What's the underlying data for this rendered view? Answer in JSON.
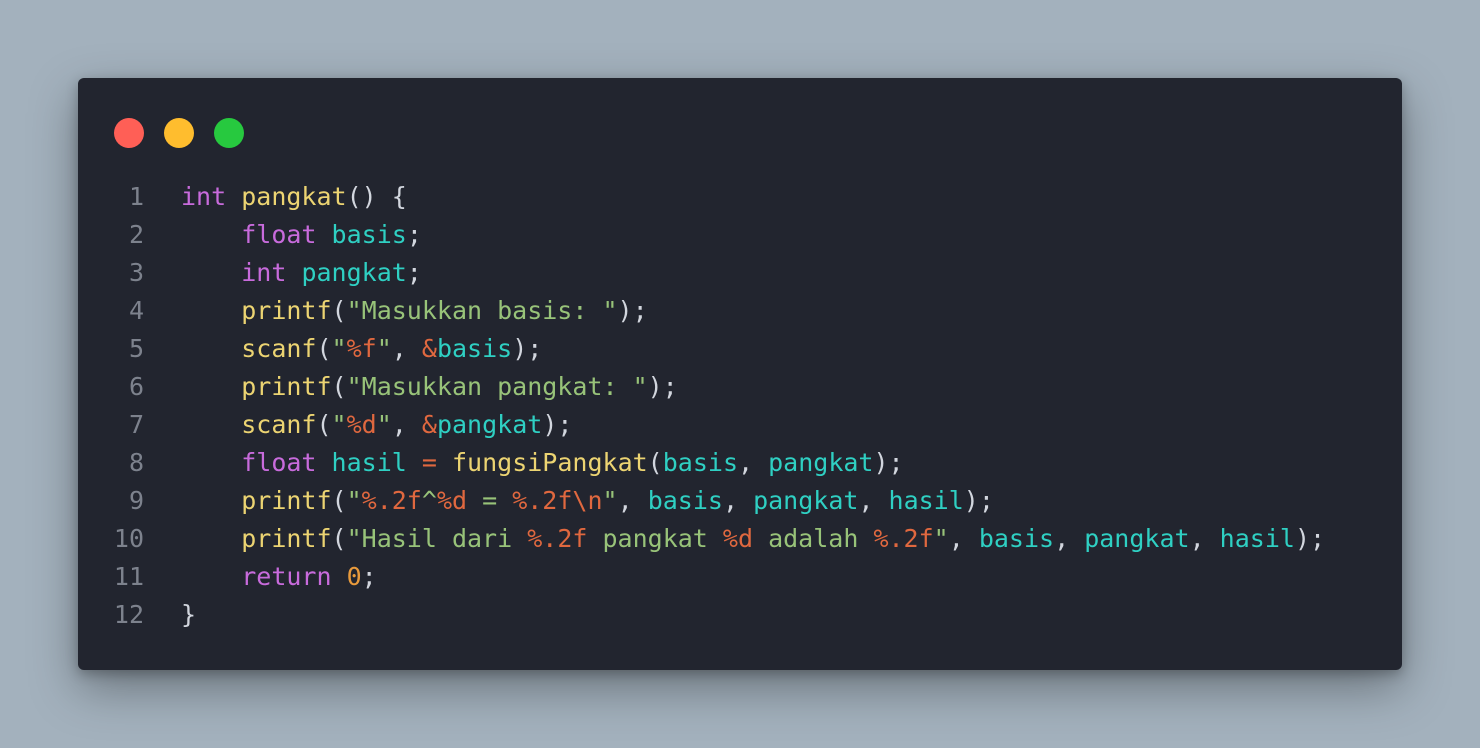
{
  "window": {
    "buttons": [
      {
        "name": "close",
        "color": "#ff5f56"
      },
      {
        "name": "minimize",
        "color": "#ffbd2e"
      },
      {
        "name": "maximize",
        "color": "#27c93f"
      }
    ]
  },
  "code": {
    "lines": [
      {
        "number": "1",
        "tokens": [
          [
            "k",
            "int"
          ],
          [
            "p",
            " "
          ],
          [
            "f",
            "pangkat"
          ],
          [
            "p",
            "() {"
          ]
        ]
      },
      {
        "number": "2",
        "tokens": [
          [
            "p",
            "    "
          ],
          [
            "k",
            "float"
          ],
          [
            "p",
            " "
          ],
          [
            "v",
            "basis"
          ],
          [
            "p",
            ";"
          ]
        ]
      },
      {
        "number": "3",
        "tokens": [
          [
            "p",
            "    "
          ],
          [
            "k",
            "int"
          ],
          [
            "p",
            " "
          ],
          [
            "v",
            "pangkat"
          ],
          [
            "p",
            ";"
          ]
        ]
      },
      {
        "number": "4",
        "tokens": [
          [
            "p",
            "    "
          ],
          [
            "f",
            "printf"
          ],
          [
            "p",
            "("
          ],
          [
            "s",
            "\"Masukkan basis: \""
          ],
          [
            "p",
            ");"
          ]
        ]
      },
      {
        "number": "5",
        "tokens": [
          [
            "p",
            "    "
          ],
          [
            "f",
            "scanf"
          ],
          [
            "p",
            "("
          ],
          [
            "s",
            "\""
          ],
          [
            "e",
            "%f"
          ],
          [
            "s",
            "\""
          ],
          [
            "p",
            ", "
          ],
          [
            "e",
            "&"
          ],
          [
            "v",
            "basis"
          ],
          [
            "p",
            ");"
          ]
        ]
      },
      {
        "number": "6",
        "tokens": [
          [
            "p",
            "    "
          ],
          [
            "f",
            "printf"
          ],
          [
            "p",
            "("
          ],
          [
            "s",
            "\"Masukkan pangkat: \""
          ],
          [
            "p",
            ");"
          ]
        ]
      },
      {
        "number": "7",
        "tokens": [
          [
            "p",
            "    "
          ],
          [
            "f",
            "scanf"
          ],
          [
            "p",
            "("
          ],
          [
            "s",
            "\""
          ],
          [
            "e",
            "%d"
          ],
          [
            "s",
            "\""
          ],
          [
            "p",
            ", "
          ],
          [
            "e",
            "&"
          ],
          [
            "v",
            "pangkat"
          ],
          [
            "p",
            ");"
          ]
        ]
      },
      {
        "number": "8",
        "tokens": [
          [
            "p",
            "    "
          ],
          [
            "k",
            "float"
          ],
          [
            "p",
            " "
          ],
          [
            "v",
            "hasil"
          ],
          [
            "p",
            " "
          ],
          [
            "e",
            "="
          ],
          [
            "p",
            " "
          ],
          [
            "f",
            "fungsiPangkat"
          ],
          [
            "p",
            "("
          ],
          [
            "v",
            "basis"
          ],
          [
            "p",
            ", "
          ],
          [
            "v",
            "pangkat"
          ],
          [
            "p",
            ");"
          ]
        ]
      },
      {
        "number": "9",
        "tokens": [
          [
            "p",
            "    "
          ],
          [
            "f",
            "printf"
          ],
          [
            "p",
            "("
          ],
          [
            "s",
            "\""
          ],
          [
            "e",
            "%.2f"
          ],
          [
            "s",
            "^"
          ],
          [
            "e",
            "%d"
          ],
          [
            "s",
            " = "
          ],
          [
            "e",
            "%.2f\\n"
          ],
          [
            "s",
            "\""
          ],
          [
            "p",
            ", "
          ],
          [
            "v",
            "basis"
          ],
          [
            "p",
            ", "
          ],
          [
            "v",
            "pangkat"
          ],
          [
            "p",
            ", "
          ],
          [
            "v",
            "hasil"
          ],
          [
            "p",
            ");"
          ]
        ]
      },
      {
        "number": "10",
        "tokens": [
          [
            "p",
            "    "
          ],
          [
            "f",
            "printf"
          ],
          [
            "p",
            "("
          ],
          [
            "s",
            "\"Hasil dari "
          ],
          [
            "e",
            "%.2f"
          ],
          [
            "s",
            " pangkat "
          ],
          [
            "e",
            "%d"
          ],
          [
            "s",
            " adalah "
          ],
          [
            "e",
            "%.2f"
          ],
          [
            "s",
            "\""
          ],
          [
            "p",
            ", "
          ],
          [
            "v",
            "basis"
          ],
          [
            "p",
            ", "
          ],
          [
            "v",
            "pangkat"
          ],
          [
            "p",
            ", "
          ],
          [
            "v",
            "hasil"
          ],
          [
            "p",
            ");"
          ]
        ]
      },
      {
        "number": "11",
        "tokens": [
          [
            "p",
            "    "
          ],
          [
            "k",
            "return"
          ],
          [
            "p",
            " "
          ],
          [
            "n",
            "0"
          ],
          [
            "p",
            ";"
          ]
        ]
      },
      {
        "number": "12",
        "tokens": [
          [
            "p",
            "}"
          ]
        ]
      }
    ]
  }
}
